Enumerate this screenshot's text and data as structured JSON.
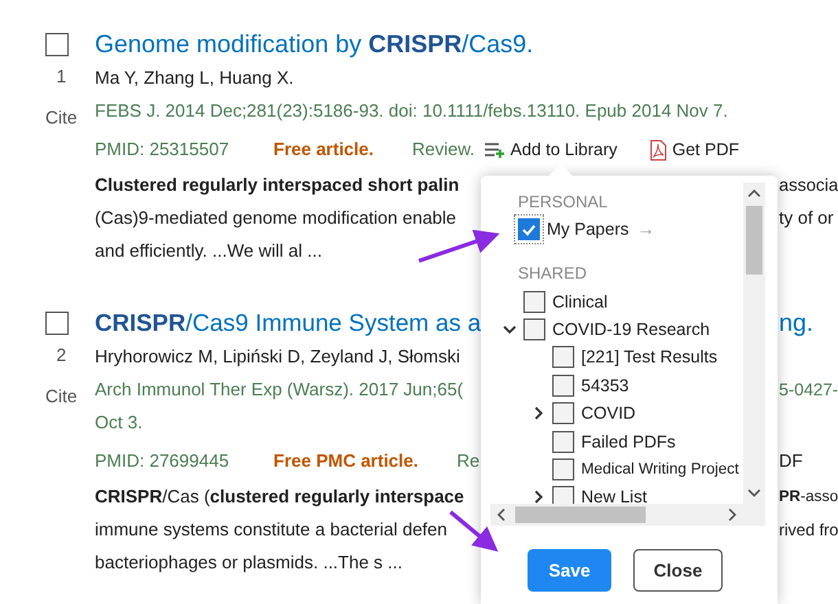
{
  "articles": [
    {
      "checked": false,
      "number": "1",
      "cite": "Cite",
      "title": {
        "text": "Genome modification by **CRISPR**/Cas9."
      },
      "authors": {
        "text": "Ma Y, Zhang L, Huang X."
      },
      "citation": [
        {
          "text": "FEBS J. 2014 Dec;281(23):5186-93. doi: 10.1111/febs.13110. Epub 2014 Nov 7."
        }
      ],
      "meta": {
        "pmid": "PMID: 25315507",
        "free": "Free article.",
        "review": "Review.",
        "actions": [
          {
            "kind": "library",
            "label": "Add to Library"
          },
          {
            "kind": "pdf",
            "label": "Get PDF"
          }
        ]
      },
      "abstract": [
        {
          "text": "**Clustered regularly interspaced short palin**",
          "tail": "associa"
        },
        {
          "text": "(Cas)9-mediated genome modification enable",
          "tail": "ty of or"
        },
        {
          "text": "and efficiently. ...We will al ..."
        }
      ]
    },
    {
      "checked": false,
      "number": "2",
      "cite": "Cite",
      "title": {
        "text": "**CRISPR**/Cas9 Immune System as a",
        "tail": "ng."
      },
      "authors": {
        "text": "Hryhorowicz M, Lipiński D, Zeyland J, Słomski"
      },
      "citation": [
        {
          "text": "Arch Immunol Ther Exp (Warsz). 2017 Jun;65(",
          "tail": "5-0427-"
        },
        {
          "text": "Oct 3."
        }
      ],
      "meta": {
        "pmid": "PMID: 27699445",
        "free": "Free PMC article.",
        "review": "Re",
        "tail": "DF"
      },
      "abstract": [
        {
          "text": "**CRISPR**/Cas (**clustered regularly interspace**",
          "tail": "**PR**-asso"
        },
        {
          "text": "immune systems constitute a bacterial defen",
          "tail": "rived fro"
        },
        {
          "text": "bacteriophages or plasmids. ...The s ..."
        }
      ]
    }
  ],
  "library_popup": {
    "sections": [
      {
        "heading": "PERSONAL",
        "items": [
          {
            "label": "My Papers",
            "checked": true,
            "focused": true,
            "link": "→"
          }
        ]
      },
      {
        "heading": "SHARED",
        "items": [
          {
            "label": "Clinical",
            "checked": false
          },
          {
            "label": "COVID-19 Research",
            "checked": false,
            "expanded": true,
            "children": [
              {
                "label": "[221] Test Results",
                "checked": false
              },
              {
                "label": "54353",
                "checked": false
              },
              {
                "label": "COVID",
                "checked": false,
                "expanded": false
              },
              {
                "label": "Failed PDFs",
                "checked": false
              },
              {
                "label": "Medical Writing Project",
                "checked": false
              },
              {
                "label": "New List",
                "checked": false,
                "expanded": false
              }
            ]
          }
        ]
      }
    ],
    "buttons": [
      {
        "kind": "primary",
        "label": "Save"
      },
      {
        "kind": "secondary",
        "label": "Close"
      }
    ]
  }
}
